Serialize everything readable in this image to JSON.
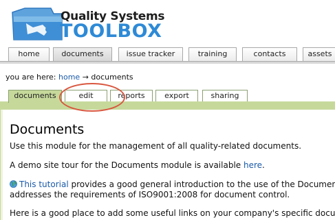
{
  "brand": {
    "line1": "Quality Systems",
    "line2": "TOOLBOX"
  },
  "main_nav": {
    "tabs": [
      "home",
      "documents",
      "issue tracker",
      "training",
      "contacts",
      "assets"
    ],
    "active": "documents"
  },
  "breadcrumb": {
    "prefix": "you are here:",
    "home": "home",
    "arrow": "→",
    "current": "documents"
  },
  "sub_tabs": {
    "tabs": [
      "documents",
      "edit",
      "reports",
      "export",
      "sharing"
    ],
    "active": "documents"
  },
  "content": {
    "title": "Documents",
    "p1": "Use this module for the management of all quality-related documents.",
    "p2_text": "A demo site tour for the Documents module is available ",
    "p2_link": "here",
    "p2_end": ".",
    "p3_link": "This tutorial",
    "p3_text": " provides a good general introduction to the use of the Documents",
    "p3_line2": "addresses the requirements of ISO9001:2008 for document control.",
    "p4": "Here is a good place to add some useful links on your company's specific docum"
  },
  "colors": {
    "accent_blue": "#2e8ad6",
    "tab_green": "#c6d99b",
    "annotation_red": "#d9573f",
    "link": "#1a5aa8"
  }
}
